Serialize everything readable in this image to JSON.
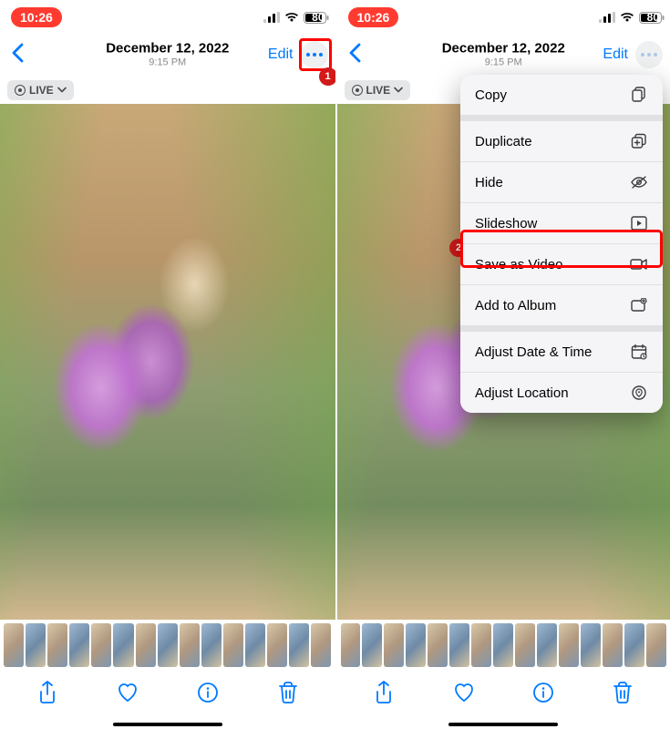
{
  "status": {
    "time": "10:26",
    "battery": "80"
  },
  "nav": {
    "title": "December 12, 2022",
    "subtitle": "9:15 PM",
    "edit": "Edit"
  },
  "live": {
    "label": "LIVE"
  },
  "toolbar": {
    "share": "share",
    "heart": "favorite",
    "info": "info",
    "trash": "delete"
  },
  "menu": {
    "copy": "Copy",
    "duplicate": "Duplicate",
    "hide": "Hide",
    "slideshow": "Slideshow",
    "saveVideo": "Save as Video",
    "addAlbum": "Add to Album",
    "adjustDate": "Adjust Date & Time",
    "adjustLocation": "Adjust Location"
  },
  "annotations": {
    "one": "1",
    "two": "2"
  }
}
